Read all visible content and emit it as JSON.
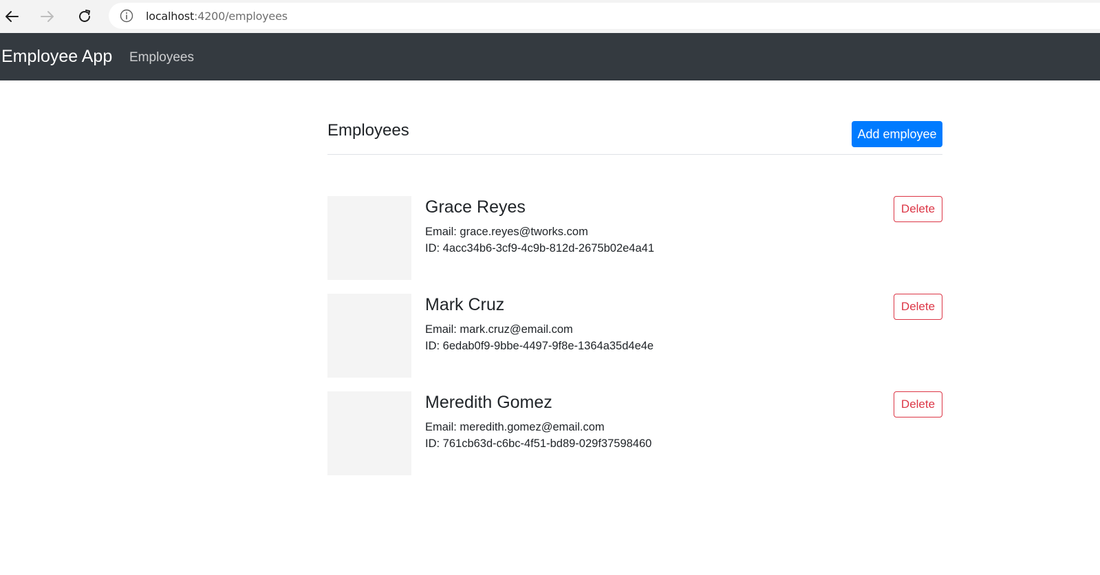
{
  "browser": {
    "url_host": "localhost",
    "url_path": ":4200/employees"
  },
  "navbar": {
    "brand": "Employee App",
    "links": [
      {
        "label": "Employees"
      }
    ]
  },
  "main": {
    "title": "Employees",
    "add_button_label": "Add employee",
    "employees": [
      {
        "name": "Grace Reyes",
        "email": "Email: grace.reyes@tworks.com",
        "id": "ID: 4acc34b6-3cf9-4c9b-812d-2675b02e4a41",
        "delete_label": "Delete"
      },
      {
        "name": "Mark Cruz",
        "email": "Email: mark.cruz@email.com",
        "id": "ID: 6edab0f9-9bbe-4497-9f8e-1364a35d4e4e",
        "delete_label": "Delete"
      },
      {
        "name": "Meredith Gomez",
        "email": "Email: meredith.gomez@email.com",
        "id": "ID: 761cb63d-c6bc-4f51-bd89-029f37598460",
        "delete_label": "Delete"
      }
    ]
  },
  "colors": {
    "navbar_bg": "#343a40",
    "primary": "#007bff",
    "danger": "#dc3545",
    "avatar_placeholder": "#f4f4f4"
  },
  "icons": [
    "back-arrow-icon",
    "forward-arrow-icon",
    "reload-icon",
    "info-icon"
  ]
}
